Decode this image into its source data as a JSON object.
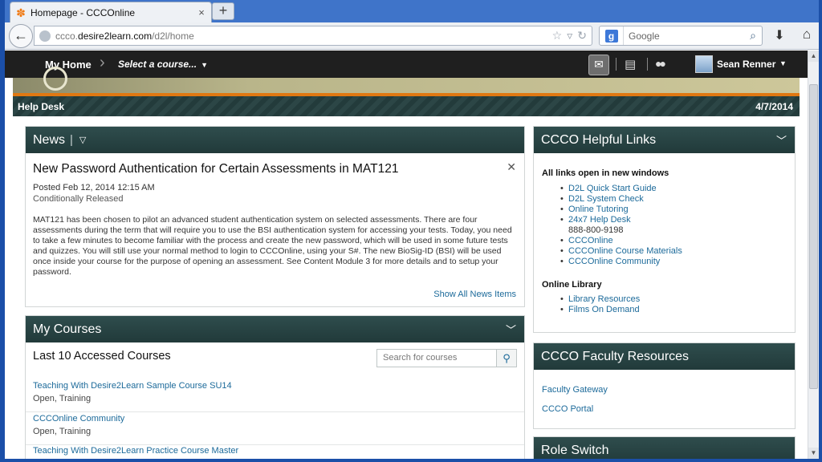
{
  "browser": {
    "tab_title": "Homepage - CCCOnline",
    "tab_close": "×",
    "new_tab": "+",
    "url_prefix": "ccco.",
    "url_domain": "desire2learn.com",
    "url_path": "/d2l/home",
    "search_engine": "g",
    "search_placeholder": "Google"
  },
  "nav": {
    "my_home": "My Home",
    "course_select": "Select a course...",
    "user_name": "Sean Renner"
  },
  "banner": {
    "help_desk": "Help Desk",
    "date": "4/7/2014"
  },
  "news": {
    "header": "News",
    "title": "New Password Authentication for Certain Assessments in MAT121",
    "posted": "Posted Feb 12, 2014 12:15 AM",
    "status": "Conditionally Released",
    "body": "MAT121 has been chosen to pilot an advanced student authentication system on selected assessments.  There are four assessments during the term that will require you to use the BSI authentication system for accessing your tests.  Today, you need to take a few minutes to become familiar with the process and create the new password, which will be used in some future tests and quizzes.  You will still use your normal method to login to CCCOnline, using your S#.  The new BioSig-ID (BSI) will be used once inside your course for the purpose of opening an assessment.  See Content Module 3 for more details and to setup your password.",
    "show_all": "Show All News Items"
  },
  "courses": {
    "header": "My Courses",
    "subheader": "Last 10 Accessed Courses",
    "search_placeholder": "Search for courses",
    "items": [
      {
        "name": "Teaching With Desire2Learn Sample Course SU14",
        "meta": "Open, Training"
      },
      {
        "name": "CCCOnline Community",
        "meta": "Open, Training"
      },
      {
        "name": "Teaching With Desire2Learn Practice Course Master",
        "meta": ""
      }
    ]
  },
  "helpful_links": {
    "header": "CCCO Helpful Links",
    "note": "All links open in new windows",
    "links": [
      "D2L Quick Start Guide",
      "D2L System Check",
      "Online Tutoring",
      "24x7 Help Desk",
      "888-800-9198",
      "CCCOnline",
      "CCCOnline Course Materials",
      "CCCOnline Community"
    ],
    "library_header": "Online Library",
    "library_links": [
      "Library Resources",
      "Films On Demand"
    ]
  },
  "faculty": {
    "header": "CCCO Faculty Resources",
    "links": [
      "Faculty Gateway",
      "CCCO Portal"
    ]
  },
  "role_switch": {
    "header": "Role Switch"
  },
  "colors": {
    "widget_header": "#2f4d4d",
    "nav_bar": "#1f1f1f",
    "accent_orange": "#e07812",
    "link_blue": "#1c6a9a",
    "window_frame": "#1b4fa8"
  }
}
